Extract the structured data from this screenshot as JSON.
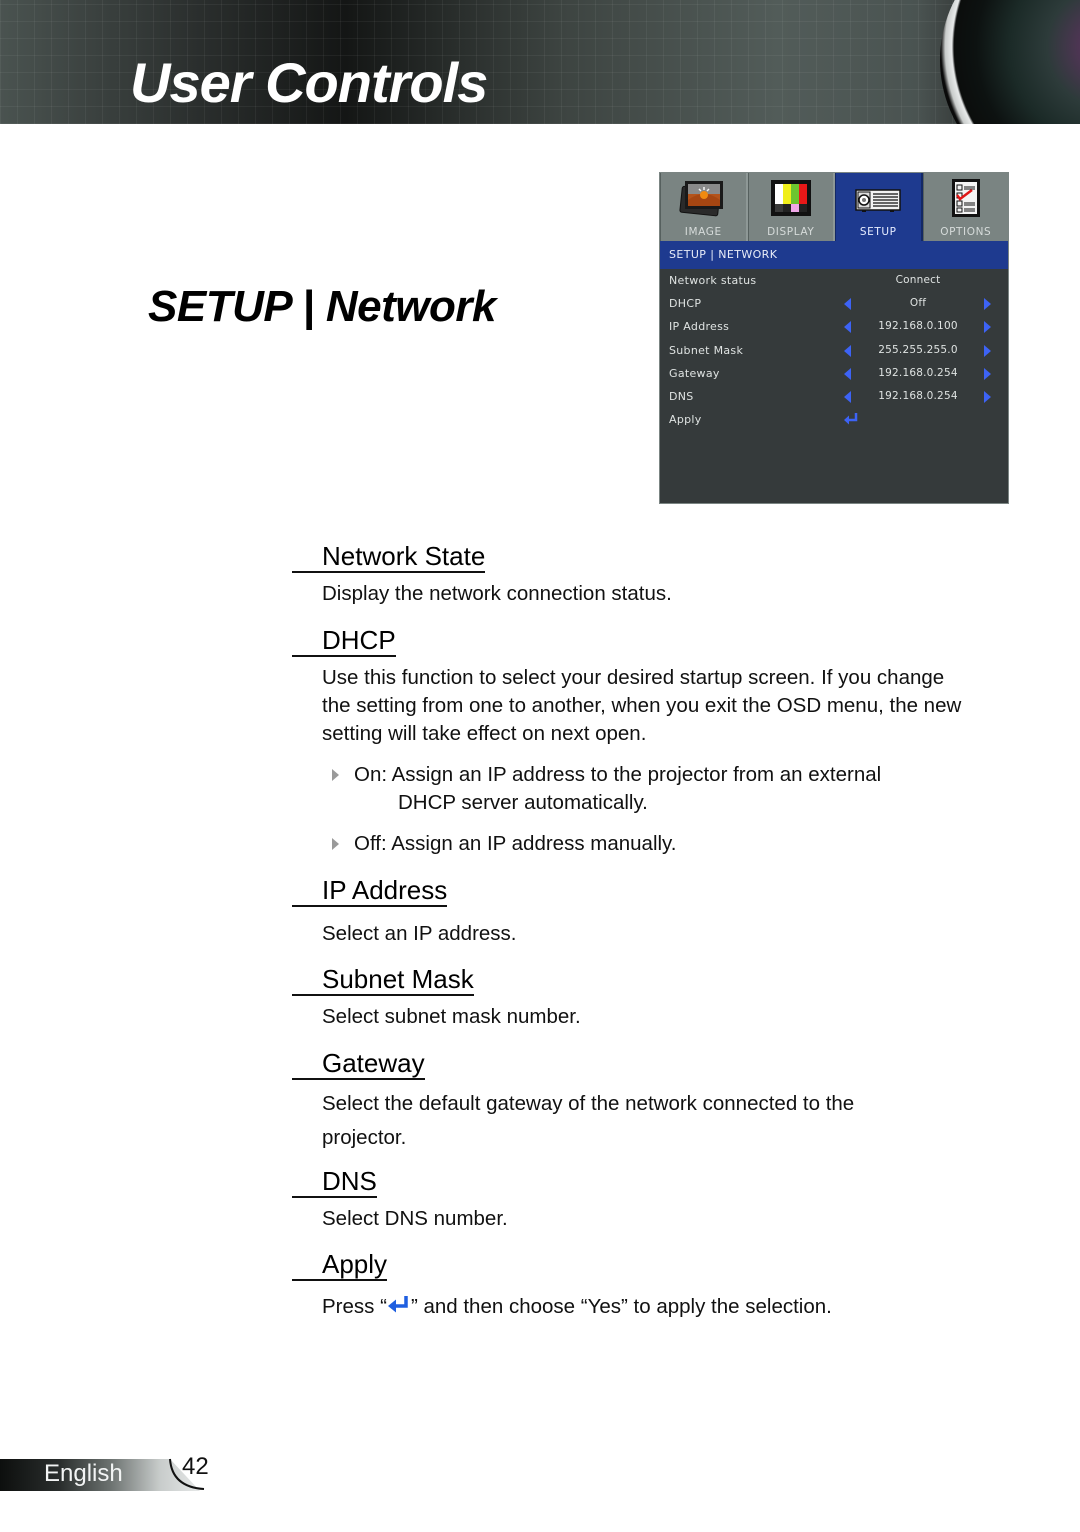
{
  "header": {
    "title": "User Controls"
  },
  "section": {
    "title": "SETUP | Network"
  },
  "osd": {
    "tabs": [
      {
        "label": "IMAGE",
        "icon": "image-icon",
        "active": false
      },
      {
        "label": "DISPLAY",
        "icon": "display-icon",
        "active": false
      },
      {
        "label": "SETUP",
        "icon": "projector-icon",
        "active": true
      },
      {
        "label": "OPTIONS",
        "icon": "checklist-icon",
        "active": false
      }
    ],
    "breadcrumb": "SETUP | NETWORK",
    "rows": [
      {
        "label": "Network status",
        "value": "Connect",
        "arrows": false
      },
      {
        "label": "DHCP",
        "value": "Off",
        "arrows": true
      },
      {
        "label": "IP Address",
        "value": "192.168.0.100",
        "arrows": true
      },
      {
        "label": "Subnet Mask",
        "value": "255.255.255.0",
        "arrows": true
      },
      {
        "label": "Gateway",
        "value": "192.168.0.254",
        "arrows": true
      },
      {
        "label": "DNS",
        "value": "192.168.0.254",
        "arrows": true
      },
      {
        "label": "Apply",
        "value": "",
        "icon": "enter-icon"
      }
    ],
    "colors": {
      "accent": "#1e3a8f",
      "arrow": "#3d63f5",
      "panel": "#353a3b",
      "tab": "#7a8482"
    }
  },
  "content": {
    "network_state": {
      "heading": "Network State",
      "text": "Display the network connection status."
    },
    "dhcp": {
      "heading": "DHCP",
      "text": "Use this function to select your desired startup screen. If you change the setting from one to another, when you exit the OSD menu, the new setting will take effect on next open.",
      "bullets": [
        {
          "line1": "On: Assign an IP address to the projector from an external",
          "line2": "DHCP server automatically."
        },
        {
          "line1": "Off: Assign an IP address manually.",
          "line2": ""
        }
      ]
    },
    "ip_address": {
      "heading": "IP Address",
      "text": "Select an IP address."
    },
    "subnet_mask": {
      "heading": "Subnet Mask",
      "text": "Select subnet mask number."
    },
    "gateway": {
      "heading": "Gateway",
      "text": "Select the default gateway of the network connected to the projector."
    },
    "dns": {
      "heading": "DNS",
      "text": "Select DNS number."
    },
    "apply": {
      "heading": "Apply",
      "text_before": "Press “",
      "text_after": "” and then choose “Yes” to apply the selection."
    }
  },
  "footer": {
    "language": "English",
    "page_number": "42"
  }
}
